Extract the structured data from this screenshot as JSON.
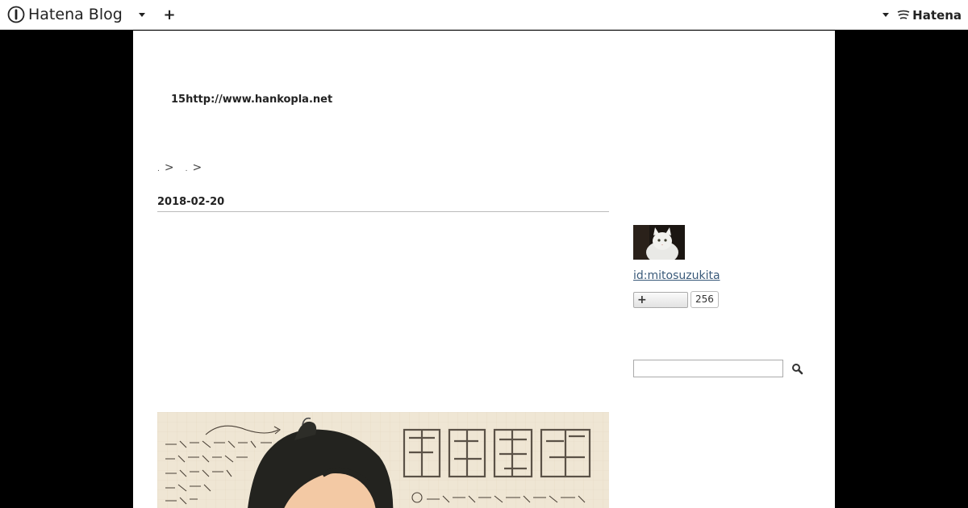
{
  "navbar": {
    "brand_label": "Hatena Blog",
    "add_label": "+",
    "right_brand_label": "Hatena"
  },
  "blog": {
    "title": "15http://www.hankopla.net"
  },
  "breadcrumb": {
    "items": [
      ">",
      ">"
    ]
  },
  "entry": {
    "date": "2018-02-20"
  },
  "sidebar": {
    "profile_id": "id:mitosuzukita",
    "follow_button_label": "+",
    "follower_count": "256"
  },
  "colors": {
    "link": "#3a5a7a",
    "page_background": "#ffffff",
    "side_background": "#000000"
  }
}
